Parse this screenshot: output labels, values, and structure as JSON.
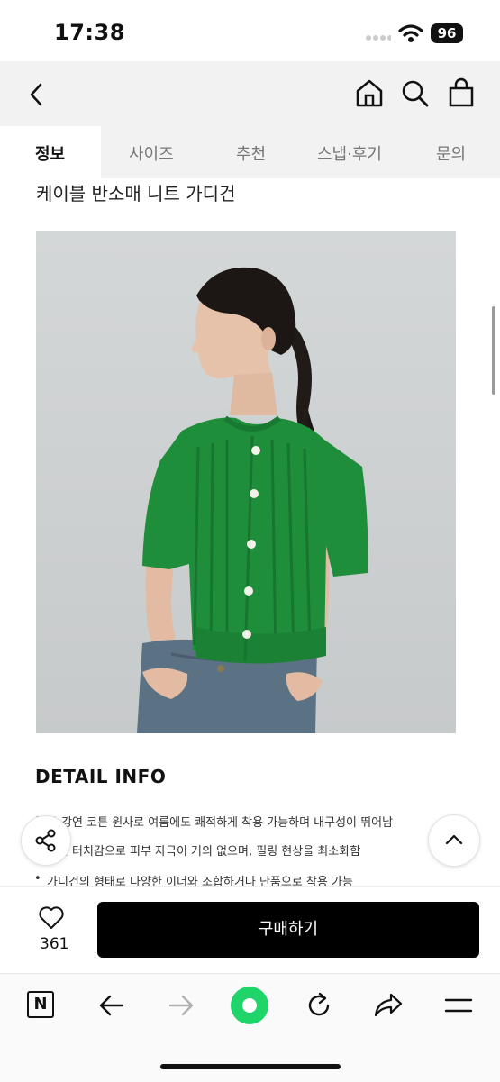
{
  "status_bar": {
    "time": "17:38",
    "battery": "96"
  },
  "tabs": [
    {
      "label": "정보"
    },
    {
      "label": "사이즈"
    },
    {
      "label": "추천"
    },
    {
      "label": "스냅·후기"
    },
    {
      "label": "문의"
    }
  ],
  "product": {
    "title": "케이블 반소매 니트 가디건"
  },
  "detail": {
    "heading": "DETAIL INFO",
    "bullets": [
      "국 강연 코튼 원사로 여름에도 쾌적하게 착용 가능하며 내구성이 뛰어남",
      "러운 터치감으로 피부 자극이 거의 없으며, 필링 현상을 최소화함",
      "가디건의 형태로 다양한 이너와 조합하거나 단품으로 착용 가능"
    ]
  },
  "bottom_bar": {
    "like_count": "361",
    "buy_label": "구매하기"
  },
  "colors": {
    "accent_green": "#1fd56a",
    "cardigan_green": "#1f8e3a",
    "buy_button": "#000000"
  }
}
